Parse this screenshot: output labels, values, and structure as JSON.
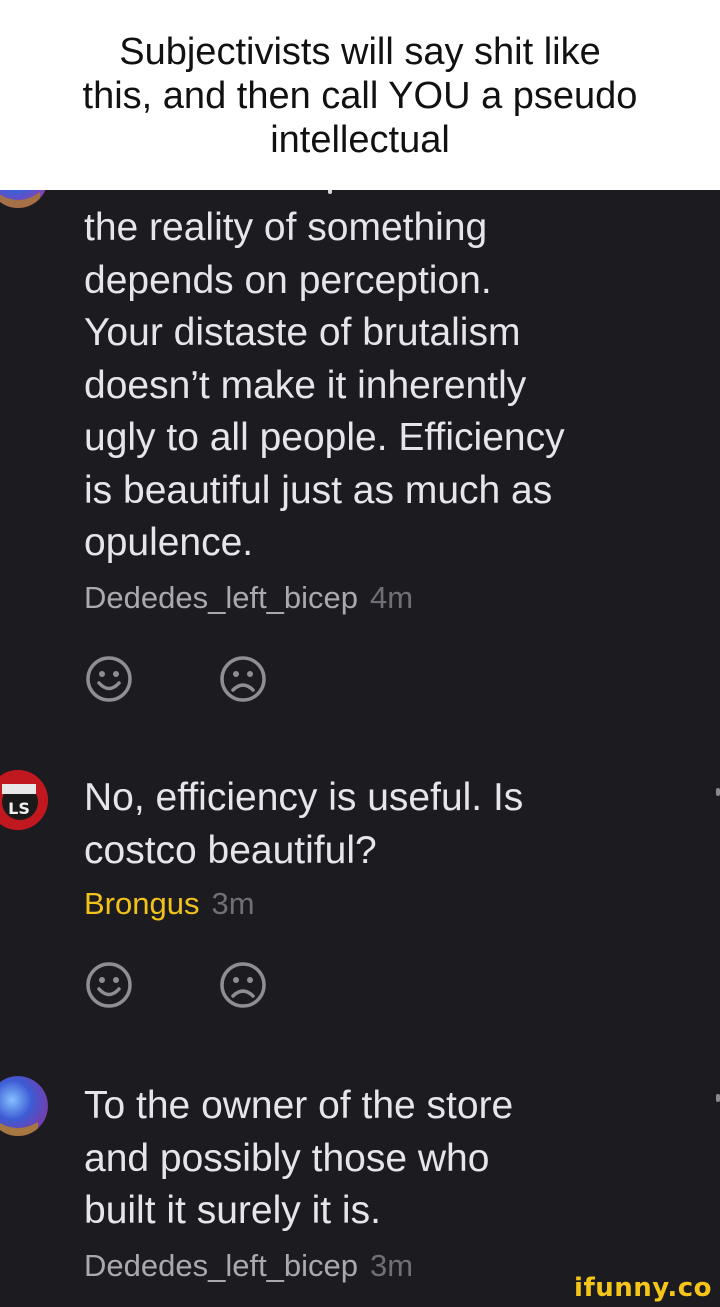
{
  "caption": {
    "lines": [
      "Subjectivists will say shit like",
      "this, and then call YOU a pseudo",
      "intellectual"
    ]
  },
  "comments": [
    {
      "lines": [
        "the reality of something",
        "depends on perception.",
        "Your distaste of brutalism",
        "doesn’t make it inherently",
        "ugly to all people. Efficiency",
        "is beautiful just as much as",
        "opulence."
      ],
      "username": "Dededes_left_bicep",
      "time": "4m"
    },
    {
      "lines": [
        "No, efficiency is useful. Is",
        "costco beautiful?"
      ],
      "username": "Brongus",
      "time": "3m",
      "username_color": "#f2c21a"
    },
    {
      "lines": [
        "To the owner of the store",
        "and possibly those who",
        "built it surely it is."
      ],
      "username": "Dededes_left_bicep",
      "time": "3m"
    }
  ],
  "reactions": {
    "happy_icon": "smile-face-icon",
    "sad_icon": "frown-face-icon"
  },
  "watermark": "ifunny.co",
  "colors": {
    "background": "#1b1b20",
    "text": "#e6e6ea",
    "username": "#a9a9b0",
    "highlight_username": "#f2c21a",
    "time": "#6f6f77",
    "watermark": "#f5c518"
  }
}
